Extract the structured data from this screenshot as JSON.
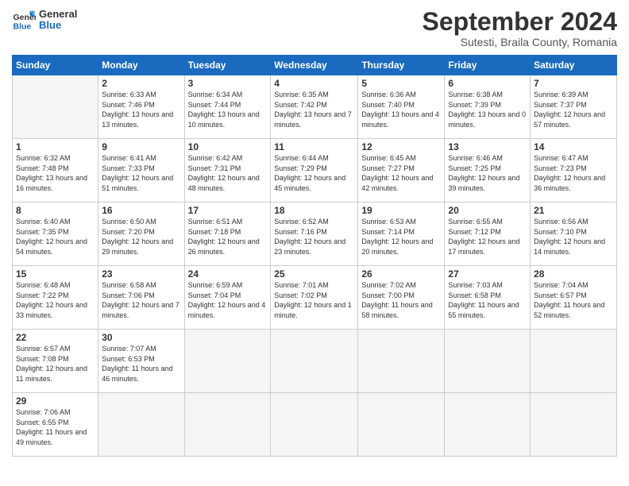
{
  "header": {
    "logo_line1": "General",
    "logo_line2": "Blue",
    "month_title": "September 2024",
    "subtitle": "Sutesti, Braila County, Romania"
  },
  "calendar": {
    "days_of_week": [
      "Sunday",
      "Monday",
      "Tuesday",
      "Wednesday",
      "Thursday",
      "Friday",
      "Saturday"
    ],
    "weeks": [
      [
        {
          "day": "",
          "info": ""
        },
        {
          "day": "2",
          "info": "Sunrise: 6:33 AM\nSunset: 7:46 PM\nDaylight: 13 hours\nand 13 minutes."
        },
        {
          "day": "3",
          "info": "Sunrise: 6:34 AM\nSunset: 7:44 PM\nDaylight: 13 hours\nand 10 minutes."
        },
        {
          "day": "4",
          "info": "Sunrise: 6:35 AM\nSunset: 7:42 PM\nDaylight: 13 hours\nand 7 minutes."
        },
        {
          "day": "5",
          "info": "Sunrise: 6:36 AM\nSunset: 7:40 PM\nDaylight: 13 hours\nand 4 minutes."
        },
        {
          "day": "6",
          "info": "Sunrise: 6:38 AM\nSunset: 7:39 PM\nDaylight: 13 hours\nand 0 minutes."
        },
        {
          "day": "7",
          "info": "Sunrise: 6:39 AM\nSunset: 7:37 PM\nDaylight: 12 hours\nand 57 minutes."
        }
      ],
      [
        {
          "day": "1",
          "info": "Sunrise: 6:32 AM\nSunset: 7:48 PM\nDaylight: 13 hours\nand 16 minutes."
        },
        {
          "day": "9",
          "info": "Sunrise: 6:41 AM\nSunset: 7:33 PM\nDaylight: 12 hours\nand 51 minutes."
        },
        {
          "day": "10",
          "info": "Sunrise: 6:42 AM\nSunset: 7:31 PM\nDaylight: 12 hours\nand 48 minutes."
        },
        {
          "day": "11",
          "info": "Sunrise: 6:44 AM\nSunset: 7:29 PM\nDaylight: 12 hours\nand 45 minutes."
        },
        {
          "day": "12",
          "info": "Sunrise: 6:45 AM\nSunset: 7:27 PM\nDaylight: 12 hours\nand 42 minutes."
        },
        {
          "day": "13",
          "info": "Sunrise: 6:46 AM\nSunset: 7:25 PM\nDaylight: 12 hours\nand 39 minutes."
        },
        {
          "day": "14",
          "info": "Sunrise: 6:47 AM\nSunset: 7:23 PM\nDaylight: 12 hours\nand 36 minutes."
        }
      ],
      [
        {
          "day": "8",
          "info": "Sunrise: 6:40 AM\nSunset: 7:35 PM\nDaylight: 12 hours\nand 54 minutes."
        },
        {
          "day": "16",
          "info": "Sunrise: 6:50 AM\nSunset: 7:20 PM\nDaylight: 12 hours\nand 29 minutes."
        },
        {
          "day": "17",
          "info": "Sunrise: 6:51 AM\nSunset: 7:18 PM\nDaylight: 12 hours\nand 26 minutes."
        },
        {
          "day": "18",
          "info": "Sunrise: 6:52 AM\nSunset: 7:16 PM\nDaylight: 12 hours\nand 23 minutes."
        },
        {
          "day": "19",
          "info": "Sunrise: 6:53 AM\nSunset: 7:14 PM\nDaylight: 12 hours\nand 20 minutes."
        },
        {
          "day": "20",
          "info": "Sunrise: 6:55 AM\nSunset: 7:12 PM\nDaylight: 12 hours\nand 17 minutes."
        },
        {
          "day": "21",
          "info": "Sunrise: 6:56 AM\nSunset: 7:10 PM\nDaylight: 12 hours\nand 14 minutes."
        }
      ],
      [
        {
          "day": "15",
          "info": "Sunrise: 6:48 AM\nSunset: 7:22 PM\nDaylight: 12 hours\nand 33 minutes."
        },
        {
          "day": "23",
          "info": "Sunrise: 6:58 AM\nSunset: 7:06 PM\nDaylight: 12 hours\nand 7 minutes."
        },
        {
          "day": "24",
          "info": "Sunrise: 6:59 AM\nSunset: 7:04 PM\nDaylight: 12 hours\nand 4 minutes."
        },
        {
          "day": "25",
          "info": "Sunrise: 7:01 AM\nSunset: 7:02 PM\nDaylight: 12 hours\nand 1 minute."
        },
        {
          "day": "26",
          "info": "Sunrise: 7:02 AM\nSunset: 7:00 PM\nDaylight: 11 hours\nand 58 minutes."
        },
        {
          "day": "27",
          "info": "Sunrise: 7:03 AM\nSunset: 6:58 PM\nDaylight: 11 hours\nand 55 minutes."
        },
        {
          "day": "28",
          "info": "Sunrise: 7:04 AM\nSunset: 6:57 PM\nDaylight: 11 hours\nand 52 minutes."
        }
      ],
      [
        {
          "day": "22",
          "info": "Sunrise: 6:57 AM\nSunset: 7:08 PM\nDaylight: 12 hours\nand 11 minutes."
        },
        {
          "day": "30",
          "info": "Sunrise: 7:07 AM\nSunset: 6:53 PM\nDaylight: 11 hours\nand 46 minutes."
        },
        {
          "day": "",
          "info": ""
        },
        {
          "day": "",
          "info": ""
        },
        {
          "day": "",
          "info": ""
        },
        {
          "day": "",
          "info": ""
        },
        {
          "day": "",
          "info": ""
        }
      ],
      [
        {
          "day": "29",
          "info": "Sunrise: 7:06 AM\nSunset: 6:55 PM\nDaylight: 11 hours\nand 49 minutes."
        },
        {
          "day": "",
          "info": ""
        },
        {
          "day": "",
          "info": ""
        },
        {
          "day": "",
          "info": ""
        },
        {
          "day": "",
          "info": ""
        },
        {
          "day": "",
          "info": ""
        },
        {
          "day": "",
          "info": ""
        }
      ]
    ]
  }
}
